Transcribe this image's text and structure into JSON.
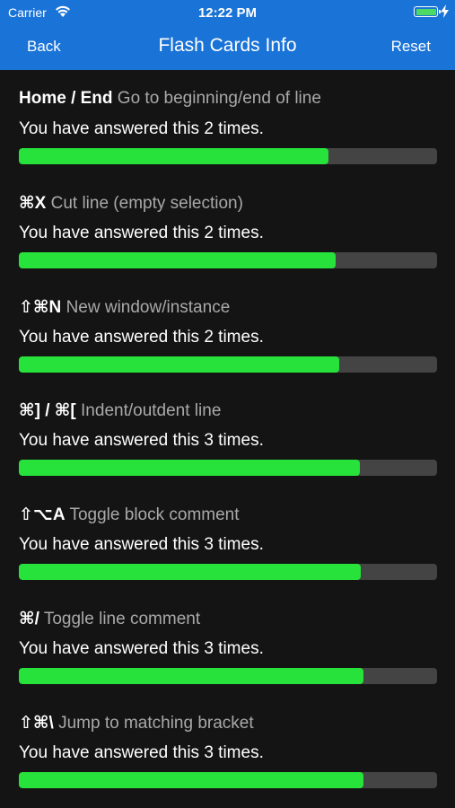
{
  "status_bar": {
    "carrier": "Carrier",
    "time": "12:22 PM",
    "battery_level": 1.0
  },
  "nav": {
    "back_label": "Back",
    "title": "Flash Cards Info",
    "reset_label": "Reset"
  },
  "colors": {
    "nav_bar": "#1a73d6",
    "background": "#141414",
    "progress_fill": "#27e23a",
    "progress_track": "#444444",
    "description_text": "#a9a9a9"
  },
  "cards": [
    {
      "keys": "Home / End",
      "description": "Go to beginning/end of line",
      "answered": "You have answered this 2 times.",
      "progress": 0.74
    },
    {
      "keys": "⌘X",
      "description": "Cut line (empty selection)",
      "answered": "You have answered this 2 times.",
      "progress": 0.757
    },
    {
      "keys": "⇧⌘N",
      "description": "New window/instance",
      "answered": "You have answered this 2 times.",
      "progress": 0.766
    },
    {
      "keys": "⌘] / ⌘[",
      "description": "Indent/outdent line",
      "answered": "You have answered this 3 times.",
      "progress": 0.815
    },
    {
      "keys": "⇧⌥A",
      "description": "Toggle block comment",
      "answered": "You have answered this 3 times.",
      "progress": 0.818
    },
    {
      "keys": "⌘/",
      "description": "Toggle line comment",
      "answered": "You have answered this 3 times.",
      "progress": 0.823
    },
    {
      "keys": "⇧⌘\\",
      "description": "Jump to matching bracket",
      "answered": "You have answered this 3 times.",
      "progress": 0.823
    }
  ]
}
